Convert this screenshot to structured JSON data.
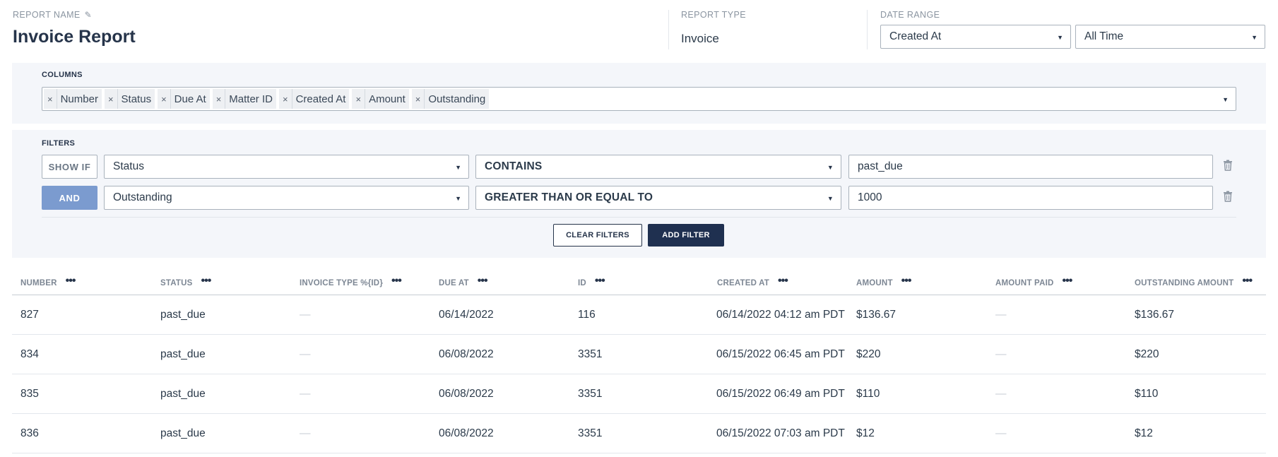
{
  "header": {
    "report_name_label": "REPORT NAME",
    "report_name": "Invoice Report",
    "report_type_label": "REPORT TYPE",
    "report_type": "Invoice",
    "date_range_label": "DATE RANGE",
    "date_field": "Created At",
    "date_period": "All Time"
  },
  "columns": {
    "label": "COLUMNS",
    "tags": [
      "Number",
      "Status",
      "Due At",
      "Matter ID",
      "Created At",
      "Amount",
      "Outstanding"
    ]
  },
  "filters": {
    "label": "FILTERS",
    "rows": [
      {
        "condition": "SHOW IF",
        "field": "Status",
        "operator": "CONTAINS",
        "value": "past_due"
      },
      {
        "condition": "AND",
        "field": "Outstanding",
        "operator": "GREATER THAN OR EQUAL TO",
        "value": "1000"
      }
    ],
    "clear_label": "CLEAR FILTERS",
    "add_label": "ADD FILTER"
  },
  "table": {
    "headers": [
      "NUMBER",
      "STATUS",
      "INVOICE TYPE %{ID}",
      "DUE AT",
      "ID",
      "CREATED AT",
      "AMOUNT",
      "AMOUNT PAID",
      "OUTSTANDING AMOUNT"
    ],
    "rows": [
      [
        "827",
        "past_due",
        "—",
        "06/14/2022",
        "116",
        "06/14/2022 04:12 am PDT",
        "$136.67",
        "—",
        "$136.67"
      ],
      [
        "834",
        "past_due",
        "—",
        "06/08/2022",
        "3351",
        "06/15/2022 06:45 am PDT",
        "$220",
        "—",
        "$220"
      ],
      [
        "835",
        "past_due",
        "—",
        "06/08/2022",
        "3351",
        "06/15/2022 06:49 am PDT",
        "$110",
        "—",
        "$110"
      ],
      [
        "836",
        "past_due",
        "—",
        "06/08/2022",
        "3351",
        "06/15/2022 07:03 am PDT",
        "$12",
        "—",
        "$12"
      ]
    ]
  },
  "icons": {
    "edit": "pencil-icon",
    "remove_tag": "close-icon",
    "dropdown": "chevron-down-icon",
    "delete": "trash-icon",
    "column_menu": "more-icon"
  },
  "colors": {
    "primary_dark": "#1f3050",
    "and_button": "#7b9bcf",
    "panel_bg": "#f4f6fa"
  }
}
